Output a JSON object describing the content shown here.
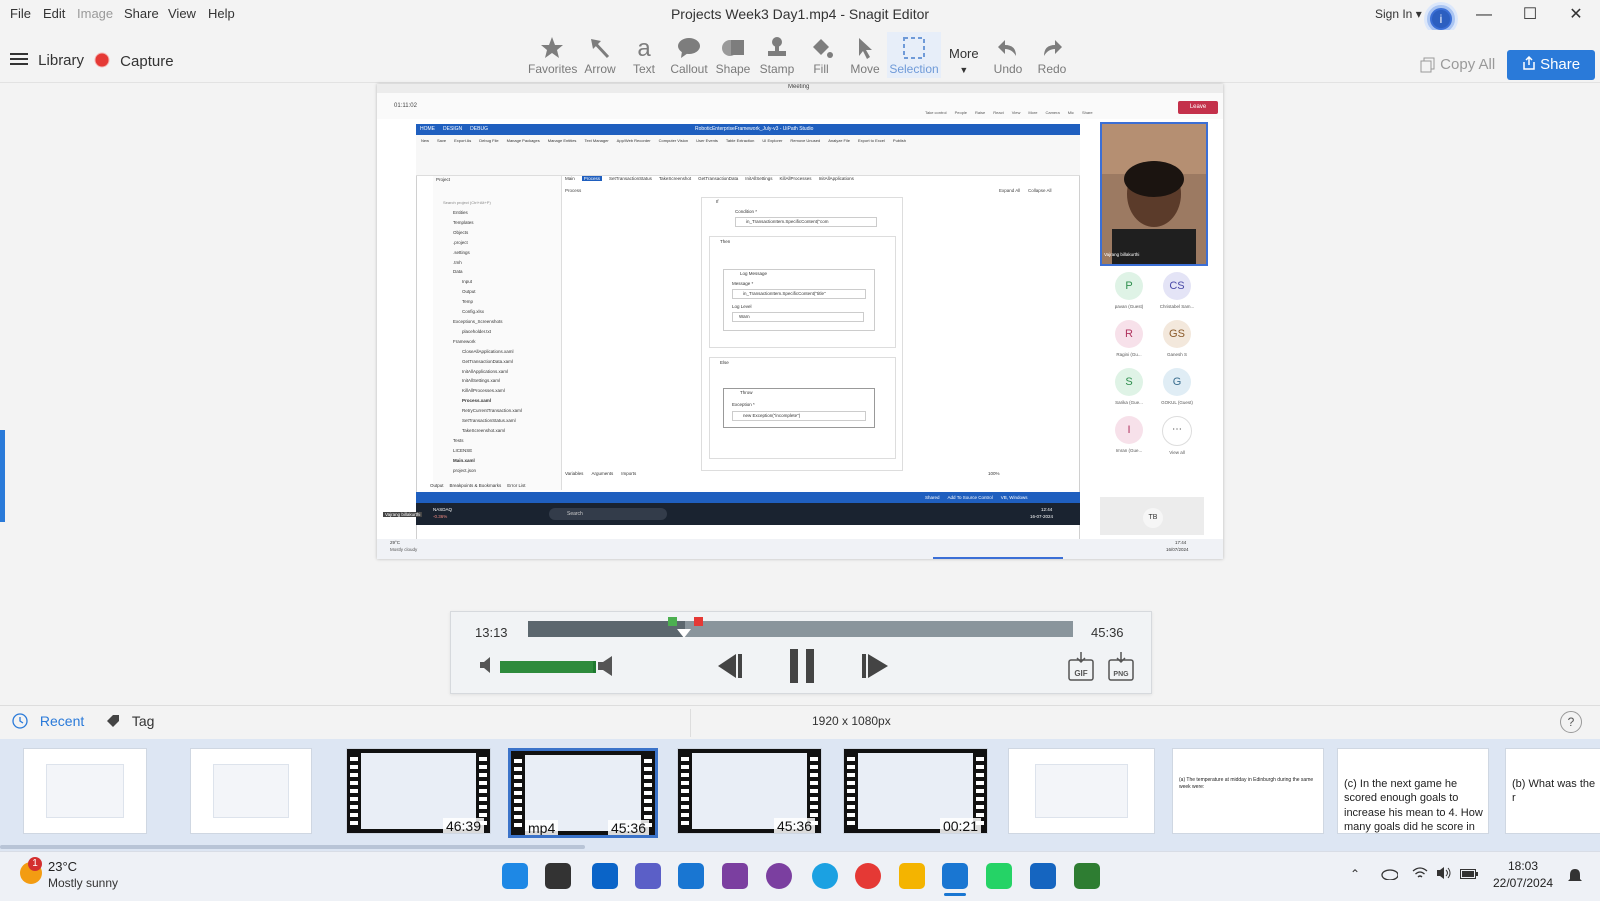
{
  "app": {
    "title": "Projects Week3 Day1.mp4 - Snagit Editor",
    "menu": [
      "File",
      "Edit",
      "Image",
      "Share",
      "View",
      "Help"
    ],
    "sign_in": "Sign In"
  },
  "toolbar": {
    "library": "Library",
    "capture": "Capture",
    "tools": [
      "Favorites",
      "Arrow",
      "Text",
      "Callout",
      "Shape",
      "Stamp",
      "Fill",
      "Move",
      "Selection"
    ],
    "more": "More",
    "undo": "Undo",
    "redo": "Redo",
    "copy_all": "Copy All",
    "share": "Share"
  },
  "meeting": {
    "window_title": "Meeting",
    "timer": "01:11:02",
    "controls": [
      "Take control",
      "People",
      "Raise",
      "React",
      "View",
      "More",
      "Camera",
      "Mic",
      "Share"
    ],
    "leave": "Leave",
    "tooltip": "Unmute (Ctrl+Shift+M)",
    "presenter_name": "Vajrang billakurthi",
    "participants": [
      {
        "initials": "P",
        "name": "pavan (Guest)",
        "color": "#2f8f4e",
        "bg": "#dff3e6"
      },
      {
        "initials": "CS",
        "name": "Christabel Sam...",
        "color": "#4a4aa8",
        "bg": "#e4e4f6"
      },
      {
        "initials": "R",
        "name": "Ragini (Gu...",
        "color": "#b0325d",
        "bg": "#f7e1ea"
      },
      {
        "initials": "GS",
        "name": "Ganesh S",
        "color": "#8a5a2a",
        "bg": "#f3e8dc"
      },
      {
        "initials": "S",
        "name": "Sarika (Gue...",
        "color": "#2f8f4e",
        "bg": "#dff3e6"
      },
      {
        "initials": "G",
        "name": "GOKUL (Guest)",
        "color": "#3a6e8f",
        "bg": "#e0edf5"
      },
      {
        "initials": "I",
        "name": "Imran (Gue...",
        "color": "#b0325d",
        "bg": "#f7e1ea"
      }
    ],
    "view_all": "View all",
    "tb_initials": "TB",
    "weather": "29°C",
    "weather_desc": "Mostly cloudy",
    "clock": "17:44",
    "date": "16/07/2024"
  },
  "uipath": {
    "title": "RoboticEnterpriseFramework_July-v3 - UiPath Studio",
    "ribbon_tabs": [
      "HOME",
      "DESIGN",
      "DEBUG"
    ],
    "ribbon": [
      "New",
      "Save",
      "Export As",
      "Debug File",
      "Manage Packages",
      "Manage Entities",
      "Text Manager",
      "App/Web Recorder",
      "Computer Vision",
      "User Events",
      "Table Extraction",
      "UI Explorer",
      "Remove Unused",
      "Analyze File",
      "Export to Excel",
      "Publish"
    ],
    "doc_tabs": [
      "Main",
      "Process",
      "SetTransactionStatus",
      "TakeScreenshot",
      "GetTransactionData",
      "InitAllSettings",
      "KillAllProcesses",
      "InitAllApplications"
    ],
    "project_label": "Project",
    "search_placeholder": "Search project (Ctrl+Alt+P)",
    "tree": [
      "Entities",
      "Templates",
      "Objects",
      ".project",
      ".settings",
      ".tmh",
      "Data",
      "Input",
      "Output",
      "Temp",
      "Config.xlsx",
      "Exceptions_Screenshots",
      "placeholder.txt",
      "Framework",
      "CloseAllApplications.xaml",
      "GetTransactionData.xaml",
      "InitAllApplications.xaml",
      "InitAllSettings.xaml",
      "KillAllProcesses.xaml",
      "Process.xaml",
      "RetryCurrentTransaction.xaml",
      "SetTransactionStatus.xaml",
      "TakeScreenshot.xaml",
      "Tests",
      "LICENSE",
      "Main.xaml",
      "project.json"
    ],
    "breadcrumb": "Process",
    "expand_all": "Expand All",
    "collapse_all": "Collapse All",
    "if_label": "If",
    "condition_label": "Condition *",
    "condition_value": "in_TransactionItem.SpecificContent(\"com",
    "then_label": "Then",
    "log_message": "Log Message",
    "message_label": "Message *",
    "message_value": "in_TransactionItem.SpecificContent(\"title\"",
    "log_level_label": "Log Level",
    "log_level_value": "Warn",
    "else_label": "Else",
    "throw_label": "Throw",
    "exception_label": "Exception *",
    "exception_value": "new Exception(\"incomplete\")",
    "bottom_tabs": [
      "Variables",
      "Arguments",
      "Imports"
    ],
    "zoom": "100%",
    "panel_tabs": [
      "Output",
      "Breakpoints & Bookmarks",
      "Error List"
    ],
    "status": [
      "Shared",
      "Add To Source Control",
      "VB, Windows"
    ],
    "taskbar_search": "Search",
    "inner_time": "12:44",
    "inner_date": "16-07-2024",
    "nasdaq": "NASDAQ",
    "nasdaq_change": "-0.36%"
  },
  "player": {
    "current": "13:13",
    "total": "45:36",
    "progress": 0.29,
    "volume": 0.97
  },
  "tray": {
    "recent": "Recent",
    "tag": "Tag",
    "dimensions": "1920 x 1080px",
    "thumbs": [
      {
        "kind": "image",
        "label": ""
      },
      {
        "kind": "image",
        "label": ""
      },
      {
        "kind": "video",
        "label": "46:39"
      },
      {
        "kind": "video",
        "label": "45:36",
        "ext": "mp4",
        "selected": true
      },
      {
        "kind": "video",
        "label": "45:36"
      },
      {
        "kind": "video",
        "label": "00:21"
      },
      {
        "kind": "image",
        "label": ""
      },
      {
        "kind": "image",
        "label": "(a) The temperature at midday in Edinburgh during the same week were:"
      },
      {
        "kind": "image",
        "label": "(c) In the next game he scored enough goals to increase his mean to 4. How many goals did he score in the seventh game?"
      },
      {
        "kind": "image",
        "label": "(b) What was the r"
      }
    ]
  },
  "taskbar": {
    "temp": "23°C",
    "weather": "Mostly sunny",
    "badge": "1",
    "time": "18:03",
    "date": "22/07/2024"
  }
}
